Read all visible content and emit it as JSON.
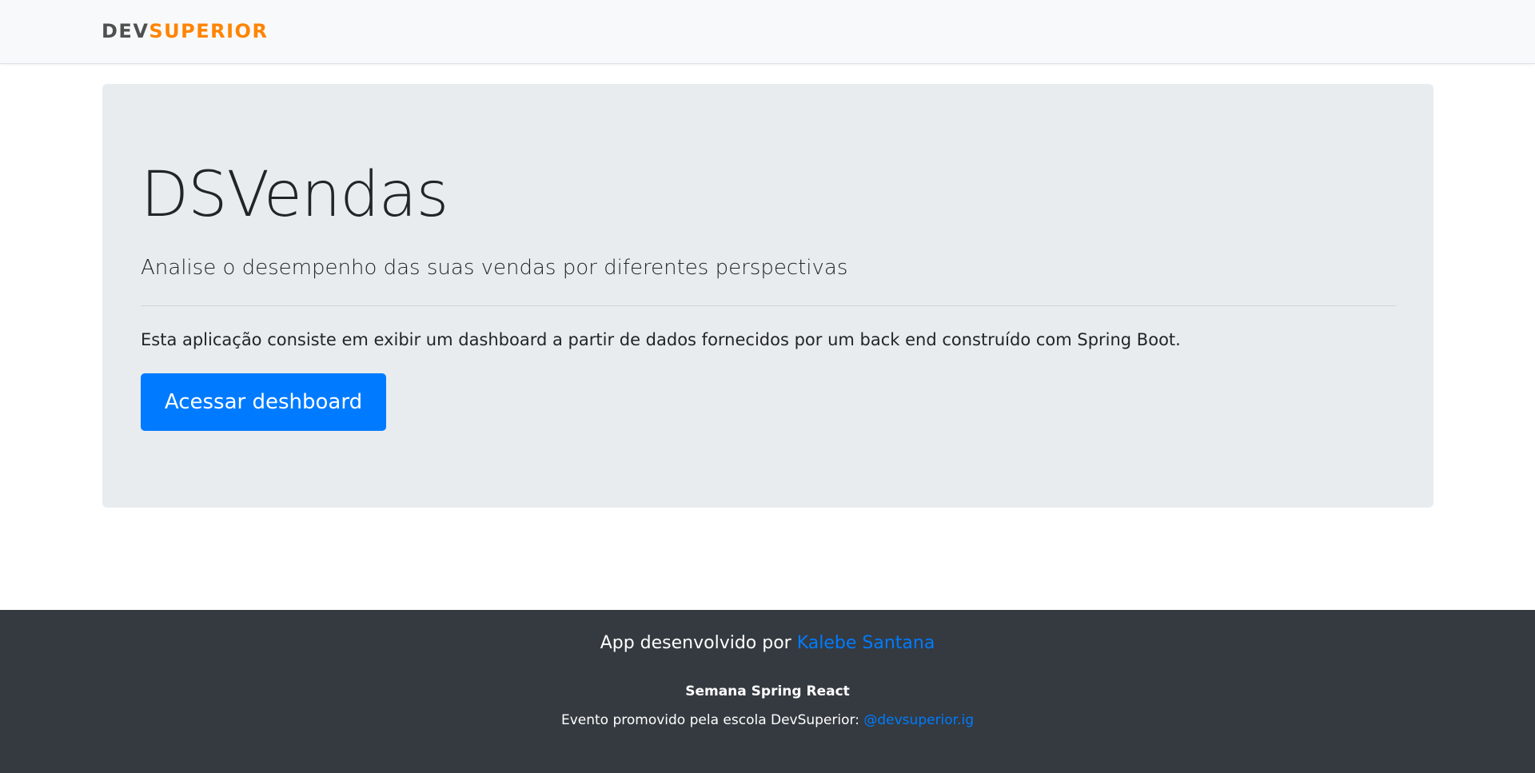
{
  "navbar": {
    "logo_dev": "DEV",
    "logo_superior": "SUPERIOR"
  },
  "hero": {
    "title": "DSVendas",
    "lead": "Analise o desempenho das suas vendas por diferentes perspectivas",
    "description": "Esta aplicação consiste em exibir um dashboard a partir de dados fornecidos por um back end construído com Spring Boot.",
    "button_label": "Acessar deshboard"
  },
  "footer": {
    "credit_prefix": "App desenvolvido por ",
    "author_name": "Kalebe Santana",
    "event_title": "Semana Spring React",
    "event_prefix": "Evento promovido pela escola DevSuperior: ",
    "event_handle": "@devsuperior.ig"
  },
  "colors": {
    "navbar_bg": "#f8f9fa",
    "logo_dev": "#505050",
    "logo_superior": "#ff8400",
    "jumbotron_bg": "#e9ecef",
    "primary": "#007bff",
    "footer_bg": "#343a40"
  }
}
